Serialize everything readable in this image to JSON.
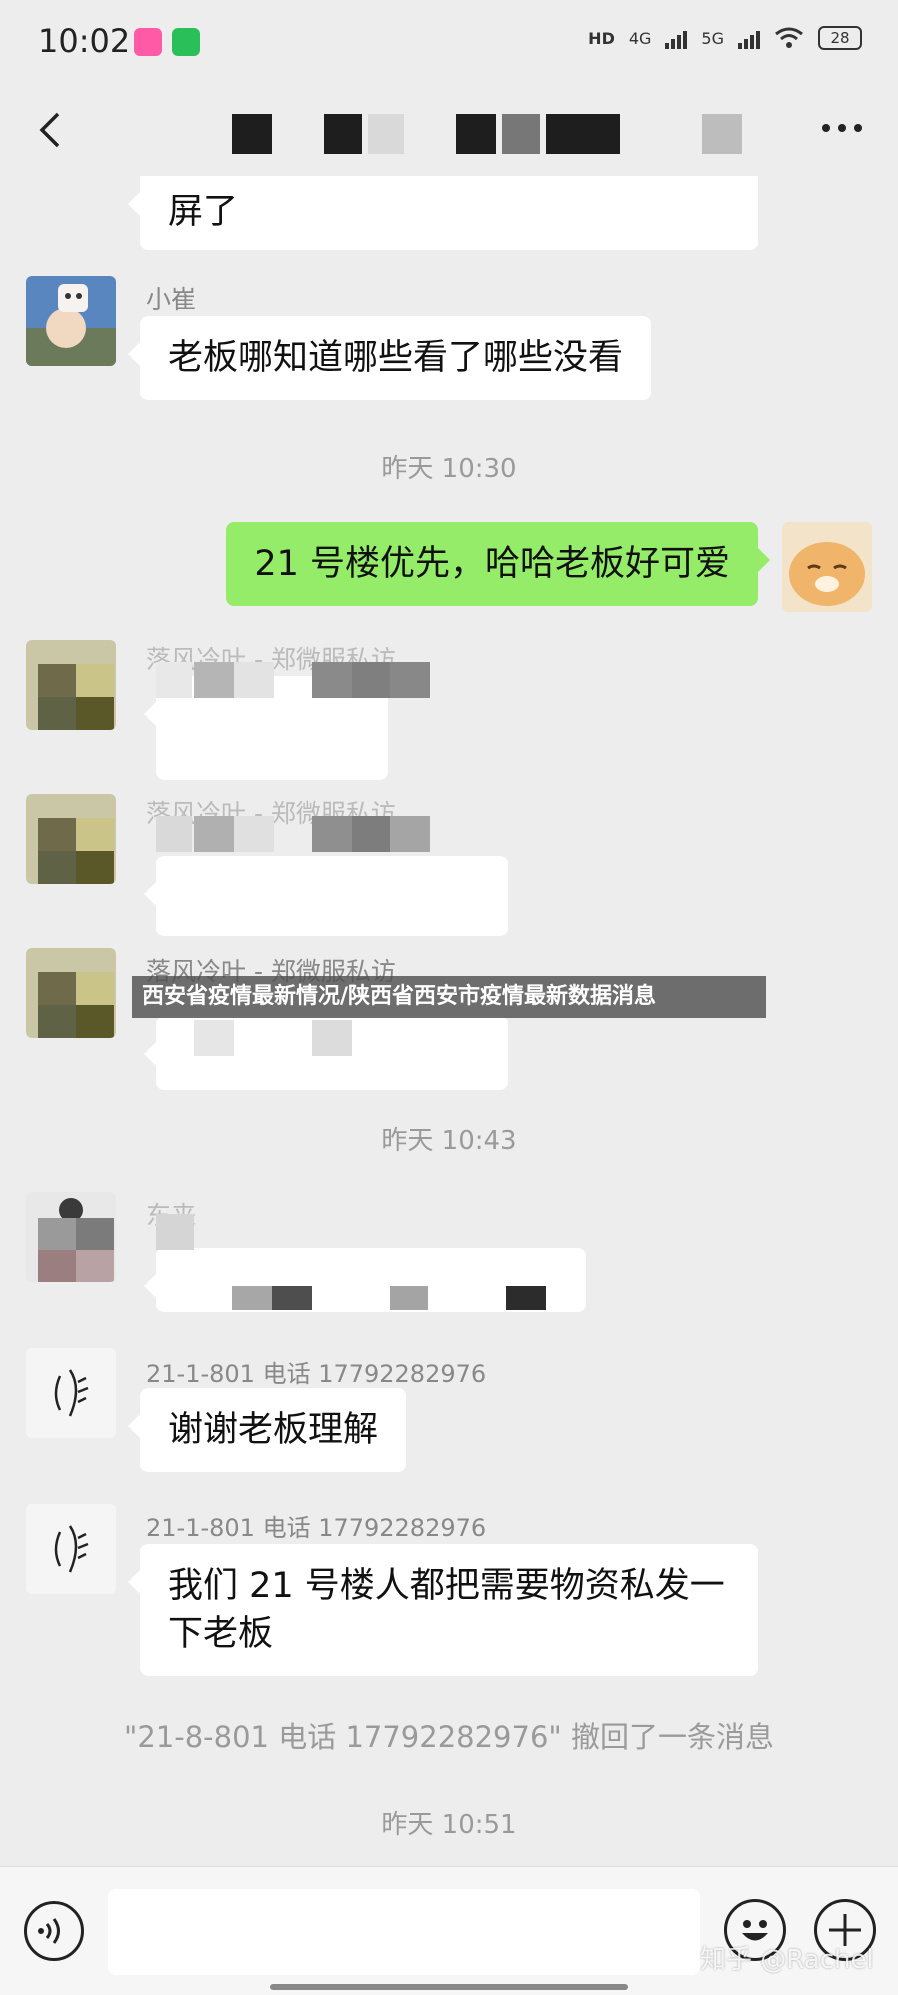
{
  "status_bar": {
    "time": "10:02",
    "hd": "HD",
    "network_1": "4G",
    "network_2": "5G",
    "battery": "28",
    "icons": [
      "music-app-icon",
      "video-app-icon",
      "wifi-icon"
    ]
  },
  "nav": {
    "back_icon": "chevron-left-icon",
    "more_icon": "ellipsis-icon"
  },
  "messages": {
    "m0": {
      "text": "屏了"
    },
    "m1": {
      "sender": "小崔",
      "text": "老板哪知道哪些看了哪些没看"
    },
    "t1": {
      "time": "昨天 10:30"
    },
    "m2": {
      "text": "21 号楼优先，哈哈老板好可爱"
    },
    "m3": {
      "sender": "落风冷叶 - 郑微服私访"
    },
    "m4": {
      "sender": "落风冷叶 - 郑微服私访"
    },
    "m5": {
      "sender": "落风冷叶 - 郑微服私访"
    },
    "t2": {
      "time": "昨天 10:43"
    },
    "m6": {
      "sender": "东来"
    },
    "m7": {
      "sender": "21-1-801  电话  17792282976",
      "text": "谢谢老板理解"
    },
    "m8": {
      "sender": "21-1-801  电话  17792282976",
      "text": "我们 21 号楼人都把需要物资私发一下老板"
    },
    "recall": {
      "text": "\"21-8-801  电话  17792282976\" 撤回了一条消息"
    },
    "t3": {
      "time": "昨天 10:51"
    }
  },
  "banner": {
    "text": "西安省疫情最新情况/陕西省西安市疫情最新数据消息"
  },
  "input_bar": {
    "placeholder": "",
    "watermark": "知乎 @Rachel"
  },
  "colors": {
    "background": "#ededed",
    "bubble_self": "#95ec69",
    "bubble_other": "#ffffff"
  }
}
